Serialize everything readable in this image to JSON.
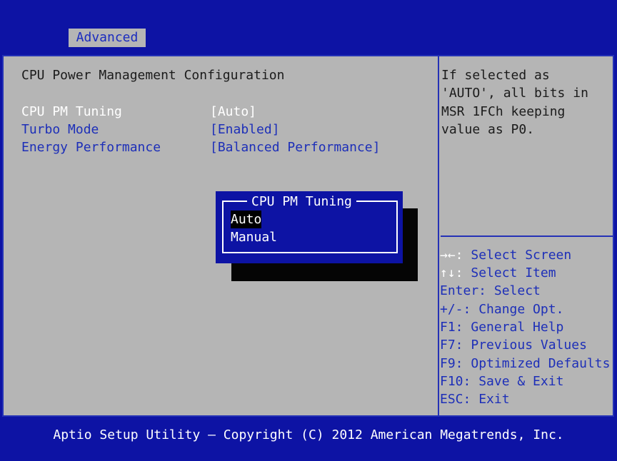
{
  "tabs": {
    "active": "Advanced"
  },
  "main": {
    "section_title": "CPU Power Management Configuration",
    "settings": [
      {
        "label": "CPU PM Tuning",
        "value": "[Auto]"
      },
      {
        "label": "Turbo Mode",
        "value": "[Enabled]"
      },
      {
        "label": "Energy Performance",
        "value": "[Balanced Performance]"
      }
    ]
  },
  "popup": {
    "title": "CPU PM Tuning",
    "options": [
      "Auto",
      "Manual"
    ],
    "selected": "Auto"
  },
  "help": {
    "description": [
      "If selected as",
      "'AUTO', all bits in",
      "MSR 1FCh keeping",
      "value as P0."
    ],
    "keys": [
      {
        "key": "→←:",
        "action": " Select Screen"
      },
      {
        "key": "↑↓:",
        "action": " Select Item"
      },
      {
        "key": "Enter:",
        "action": " Select"
      },
      {
        "key": "+/-:",
        "action": " Change Opt."
      },
      {
        "key": "F1:",
        "action": " General Help"
      },
      {
        "key": "F7:",
        "action": " Previous Values"
      },
      {
        "key": "F9:",
        "action": " Optimized Defaults"
      },
      {
        "key": "F10:",
        "action": " Save & Exit"
      },
      {
        "key": "ESC:",
        "action": " Exit"
      }
    ]
  },
  "footer": {
    "text": "Aptio Setup Utility – Copyright (C) 2012 American Megatrends, Inc."
  },
  "colors": {
    "background": "#0d13a4",
    "panel": "#b5b5b5",
    "accent_text": "#1d2fb8",
    "highlight": "#ffffff"
  }
}
